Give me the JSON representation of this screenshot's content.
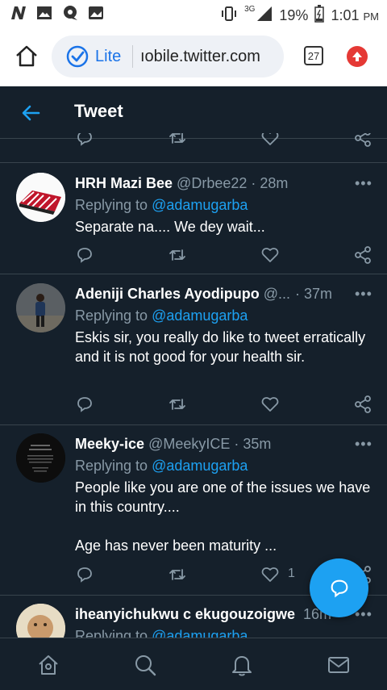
{
  "status": {
    "network": "3G",
    "battery": "19%",
    "time": "1:01",
    "ampm": "PM"
  },
  "browser": {
    "mode_label": "Lite",
    "url": "ıobile.twitter.com",
    "tabs_count": "27"
  },
  "header": {
    "title": "Tweet"
  },
  "tweets": [
    {
      "name": "HRH Mazi Bee",
      "handle": "@Drbee22",
      "sep": "·",
      "time": "28m",
      "replying_prefix": "Replying to",
      "replying_to": "@adamugarba",
      "text": "Separate na.... We dey wait..."
    },
    {
      "name": "Adeniji Charles Ayodipupo",
      "handle": "@...",
      "sep": "·",
      "time": "37m",
      "replying_prefix": "Replying to",
      "replying_to": "@adamugarba",
      "text": "Eskis sir, you really do like to tweet erratically and it is not good for your health sir."
    },
    {
      "name": "Meeky-ice",
      "handle": "@MeekyICE",
      "sep": "·",
      "time": "35m",
      "replying_prefix": "Replying to",
      "replying_to": "@adamugarba",
      "text_line1": "People like you are one of the issues we have in this country....",
      "text_line2": "Age has never been maturity ...",
      "like_count": "1"
    },
    {
      "name": "iheanyichukwu c ekugouzoigwe",
      "time": "16m",
      "replying_prefix": "Replying to",
      "replying_to": "@adamugarba"
    }
  ],
  "more_label": "•••",
  "icons": [
    "home-icon",
    "lite-icon",
    "tabs-icon",
    "update-icon",
    "back-arrow-icon",
    "reply-icon",
    "retweet-icon",
    "like-icon",
    "share-icon",
    "compose-icon",
    "nav-home-icon",
    "nav-search-icon",
    "nav-notifications-icon",
    "nav-messages-icon"
  ],
  "colors": {
    "background": "#15202b",
    "accent": "#1da1f2",
    "muted": "#8899a6",
    "divider": "#38444d"
  }
}
